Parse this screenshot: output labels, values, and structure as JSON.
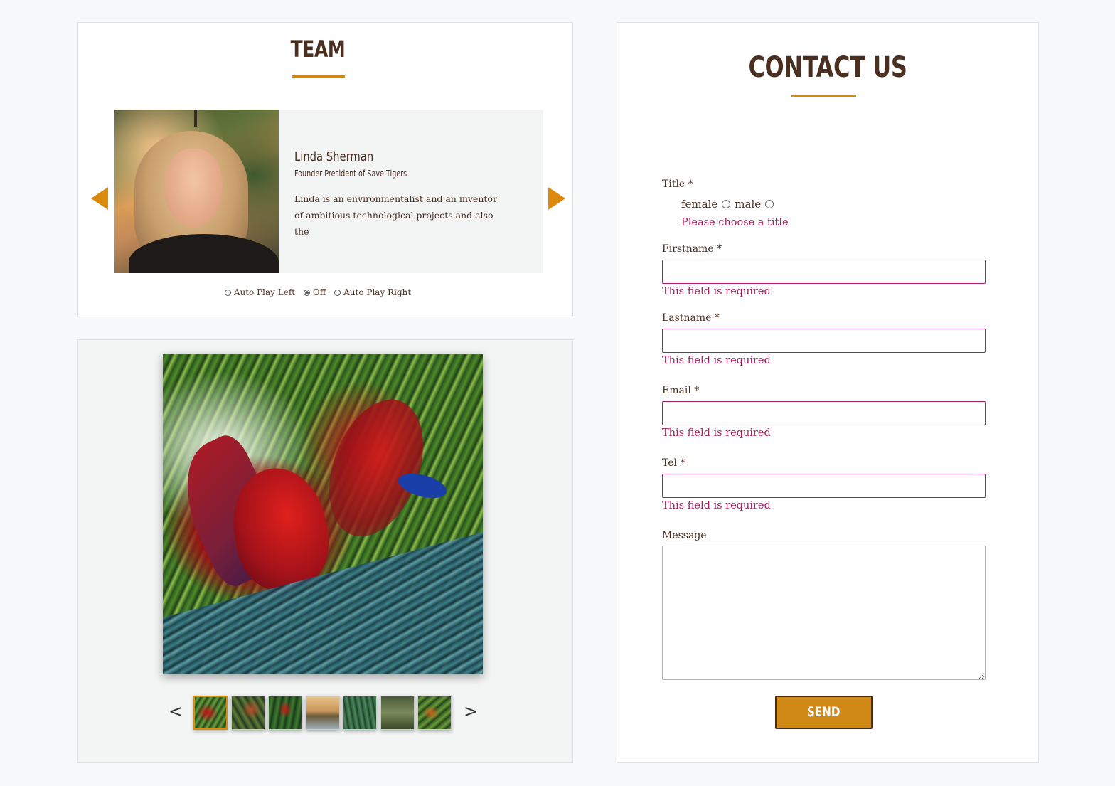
{
  "team": {
    "title": "TEAM",
    "member": {
      "name": "Linda Sherman",
      "role": "Founder President of Save Tigers",
      "bio": "Linda is an environmentalist and an inventor of ambitious technological projects and also the"
    },
    "autoplay": {
      "options": [
        "Auto Play Left",
        "Off",
        "Auto Play Right"
      ],
      "selected": "Off"
    }
  },
  "gallery": {
    "prev_label": "<",
    "next_label": ">",
    "thumbnail_count": 7,
    "active_thumbnail": 1
  },
  "contact": {
    "title": "CONTACT US",
    "title_label": "Title *",
    "title_options": [
      "female",
      "male"
    ],
    "title_error": "Please choose a title",
    "firstname_label": "Firstname *",
    "lastname_label": "Lastname *",
    "email_label": "Email *",
    "tel_label": "Tel *",
    "field_error": "This field is required",
    "message_label": "Message",
    "send_label": "SEND"
  },
  "colors": {
    "accent": "#d08817",
    "arrow": "#dc8a0e",
    "text": "#4a2e20",
    "error": "#a81e5e",
    "panel_bg": "#f3f5f5",
    "page_bg": "#f6f8fa"
  }
}
